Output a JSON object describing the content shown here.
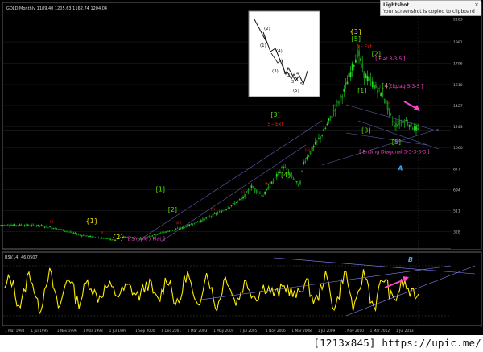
{
  "chart_header": {
    "main_title": "GOLD,Monthly 1189.40 1205.63 1162.74 1204.04",
    "rsi_title": "RSI(14) 46.0507"
  },
  "notification": {
    "title": "Lightshot",
    "text": "Your screenshot is copied to clipboard",
    "close": "×"
  },
  "footer": {
    "text": "[1213x845] https://upic.me/"
  },
  "colors": {
    "background": "#000000",
    "candle": "#22dd22",
    "wave_green": "#55dd00",
    "wave_yellow": "#ffee00",
    "wave_magenta": "#ff44cc",
    "wave_red": "#ee2200",
    "rsi_line": "#ffee00",
    "channel": "#8888ff",
    "blue_label": "#33aaff"
  },
  "icons": [
    "inset-wave-diagram",
    "pink-arrow-icon",
    "blue-wave-label-icon"
  ],
  "chart_data": [
    {
      "type": "candlestick-line",
      "series": [
        {
          "name": "GOLD",
          "x": [
            1994,
            1995,
            1996,
            1997,
            1998,
            1999,
            1999.67,
            2000,
            2001,
            2002,
            2003,
            2004,
            2005,
            2006,
            2006.4,
            2007,
            2008,
            2008.8,
            2009,
            2010,
            2011,
            2011.7,
            2012,
            2013,
            2013.5,
            2014,
            2014.7
          ],
          "values": [
            385,
            385,
            380,
            345,
            295,
            270,
            255,
            280,
            270,
            320,
            360,
            430,
            510,
            620,
            720,
            640,
            900,
            720,
            930,
            1200,
            1550,
            1900,
            1700,
            1500,
            1250,
            1300,
            1204
          ]
        }
      ],
      "y_ticks": [
        "2183",
        "1981",
        "1796",
        "1610",
        "1427",
        "1243",
        "1060",
        "877",
        "694",
        "511",
        "328"
      ],
      "annotations": {
        "wave_labels": [
          {
            "text": "{1}",
            "color": "yellow",
            "x": 1998.5,
            "y": 400
          },
          {
            "text": "{2}",
            "color": "yellow",
            "x": 1999.8,
            "y": 260
          },
          {
            "text": "[ Simple / Flat ]",
            "color": "magenta",
            "x": 2001.2,
            "y": 250
          },
          {
            "text": "{3}",
            "color": "yellow",
            "x": 2011.6,
            "y": 2050
          },
          {
            "text": "[5]",
            "color": "green",
            "x": 2011.6,
            "y": 1990
          },
          {
            "text": "5 - Ext",
            "color": "red",
            "x": 2012.0,
            "y": 1930
          },
          {
            "text": "[ Flat 3-3-5 ]",
            "color": "magenta",
            "x": 2013.3,
            "y": 1820
          },
          {
            "text": "[2]",
            "color": "green",
            "x": 2012.6,
            "y": 1860
          },
          {
            "text": "[3]",
            "color": "green",
            "x": 2007.6,
            "y": 1330
          },
          {
            "text": "5 - Ext",
            "color": "red",
            "x": 2007.6,
            "y": 1250
          },
          {
            "text": "[1]",
            "color": "green",
            "x": 2011.9,
            "y": 1540
          },
          {
            "text": "[4]",
            "color": "green",
            "x": 2013.1,
            "y": 1580
          },
          {
            "text": "[ Zigzag 5-3-5 ]",
            "color": "magenta",
            "x": 2014.0,
            "y": 1580
          },
          {
            "text": "[3]",
            "color": "green",
            "x": 2012.1,
            "y": 1190
          },
          {
            "text": "[5]",
            "color": "green",
            "x": 2013.6,
            "y": 1090
          },
          {
            "text": "[ Ending Diagonal 3-3-3-3-3 ]",
            "color": "magenta",
            "x": 2013.5,
            "y": 1010
          },
          {
            "text": "[1]",
            "color": "green",
            "x": 2001.9,
            "y": 680
          },
          {
            "text": "[2]",
            "color": "green",
            "x": 2002.5,
            "y": 500
          },
          {
            "text": "[4]",
            "color": "green",
            "x": 2008.1,
            "y": 800
          },
          {
            "text": "A",
            "color": "blue",
            "x": 2013.8,
            "y": 860
          },
          {
            "text": "B",
            "color": "blue",
            "x": 2014.3,
            "y": 0
          }
        ],
        "inset_wave_labels": [
          "(2)",
          "(4)",
          "(1)",
          "(3)",
          "(5)",
          "1",
          "2",
          "3",
          "4",
          "5"
        ],
        "x_axis_labels": [
          "1 Mar 1994",
          "1 Jul 1995",
          "1 Nov 1996",
          "1 Mar 1998",
          "1 Jul 1999",
          "1 Sep 2000",
          "1 Dec 2001",
          "1 Mar 2003",
          "1 May 2004",
          "1 Jul 2005",
          "1 Nov 2006",
          "1 Mar 2008",
          "1 Jul 2009",
          "1 Nov 2010",
          "1 Mar 2012",
          "1 Jul 2013"
        ]
      }
    },
    {
      "type": "line",
      "name": "RSI(14)",
      "series": [
        {
          "name": "RSI(14)",
          "last_value": 46.0507
        }
      ]
    }
  ]
}
